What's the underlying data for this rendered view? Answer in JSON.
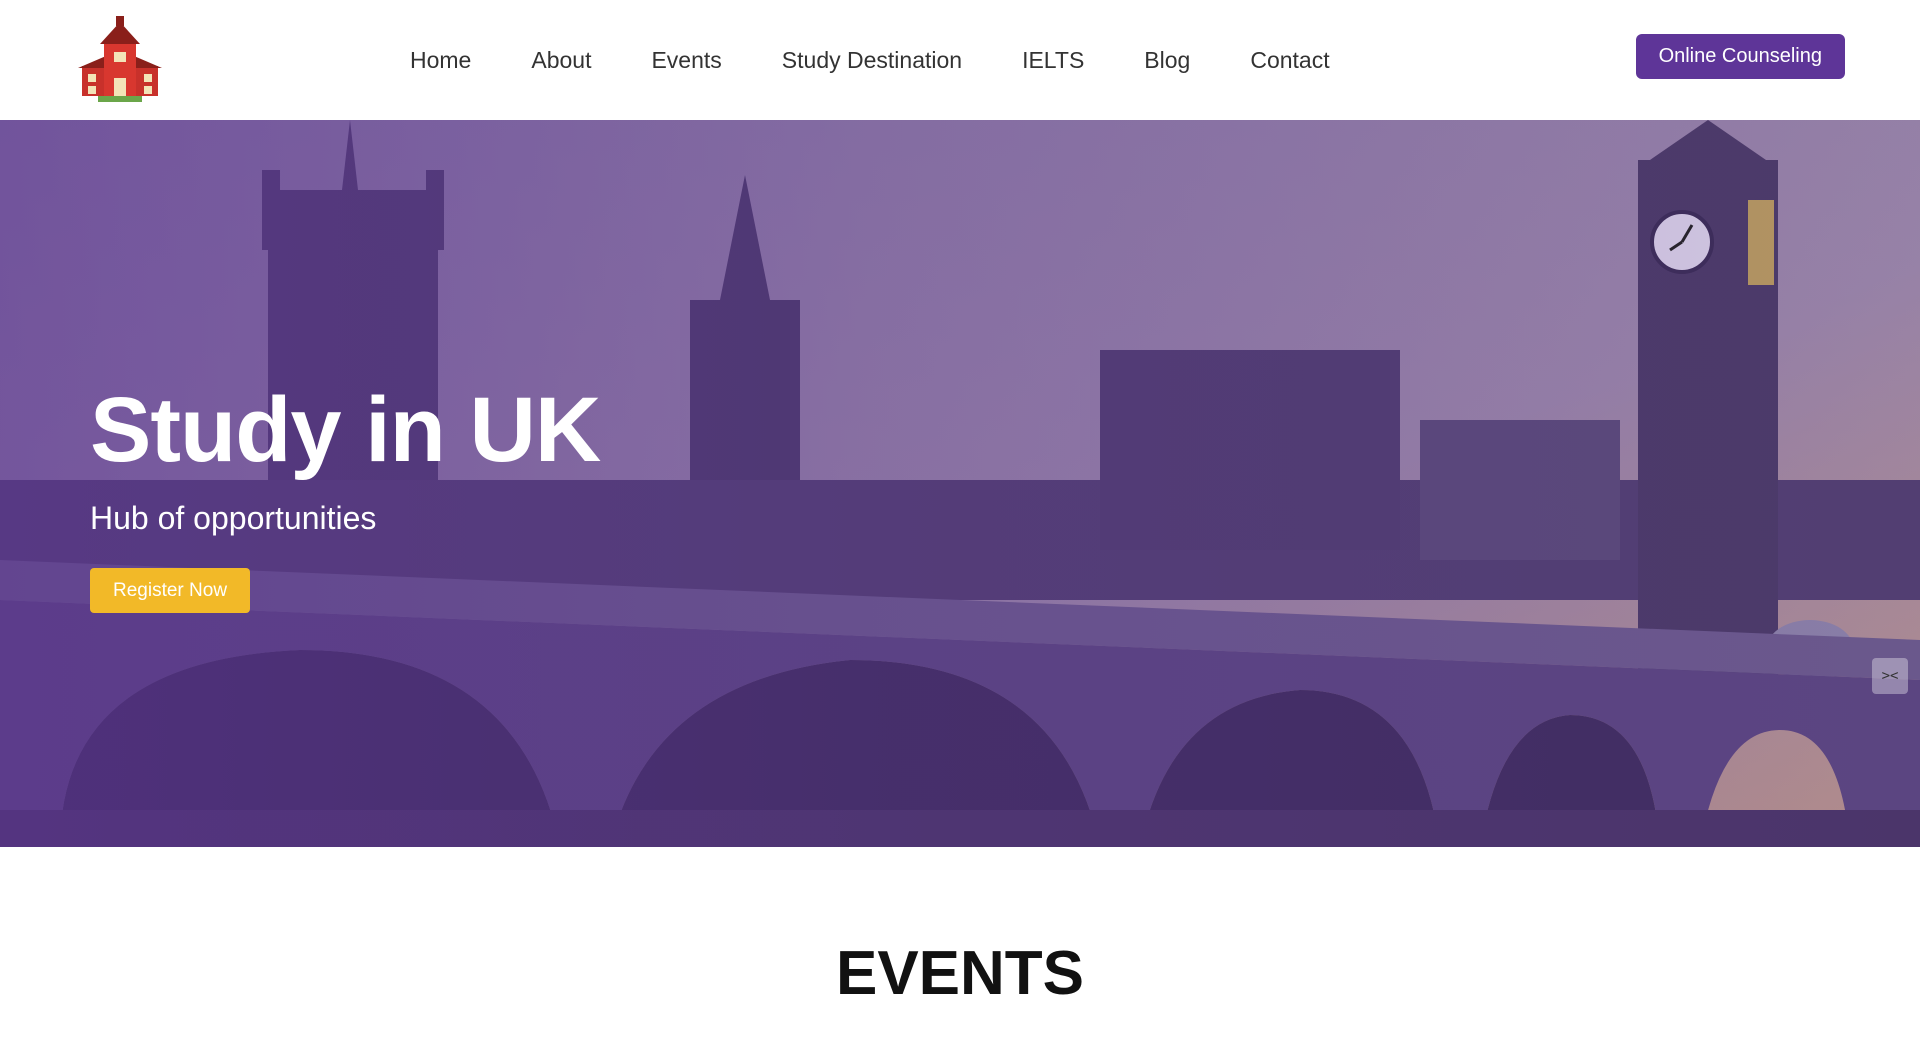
{
  "header": {
    "logo_icon": "school-building-logo",
    "nav": [
      {
        "label": "Home"
      },
      {
        "label": "About"
      },
      {
        "label": "Events"
      },
      {
        "label": "Study Destination"
      },
      {
        "label": "IELTS"
      },
      {
        "label": "Blog"
      },
      {
        "label": "Contact"
      }
    ],
    "cta_label": "Online Counseling"
  },
  "hero": {
    "title": "Study in UK",
    "subtitle": "Hub of opportunities",
    "button_label": "Register Now",
    "toggle_icon": "collapse-arrows-icon"
  },
  "events": {
    "title": "EVENTS"
  },
  "colors": {
    "brand_purple": "#5e3598",
    "accent_yellow": "#f2b928"
  }
}
